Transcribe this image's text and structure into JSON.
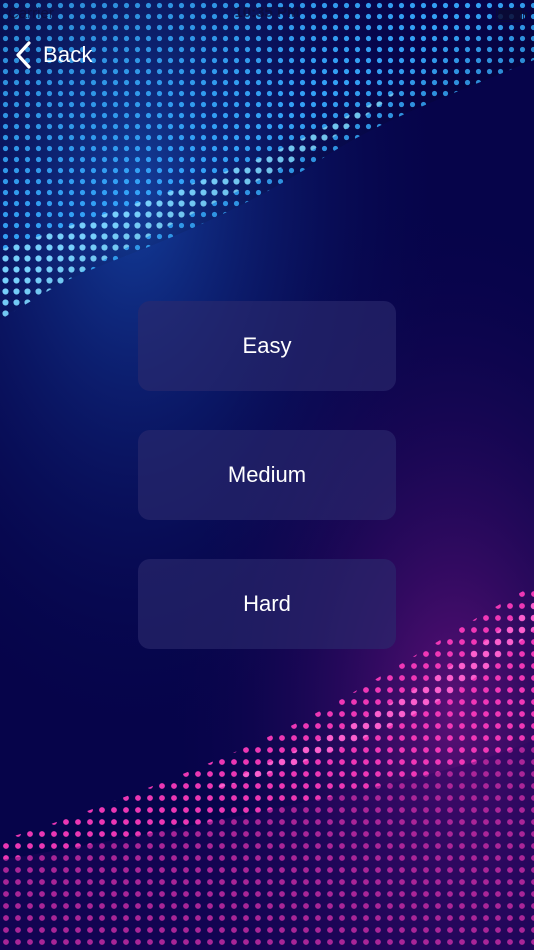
{
  "status_bar": {
    "carrier": "Carrier",
    "time": "10:35 PM"
  },
  "nav": {
    "back_label": "Back"
  },
  "difficulty": {
    "easy_label": "Easy",
    "medium_label": "Medium",
    "hard_label": "Hard"
  },
  "colors": {
    "background": "#06044a",
    "top_wave": "#1e9bff",
    "bottom_wave": "#ff1fa6",
    "button_fill": "#2c2a6e"
  }
}
